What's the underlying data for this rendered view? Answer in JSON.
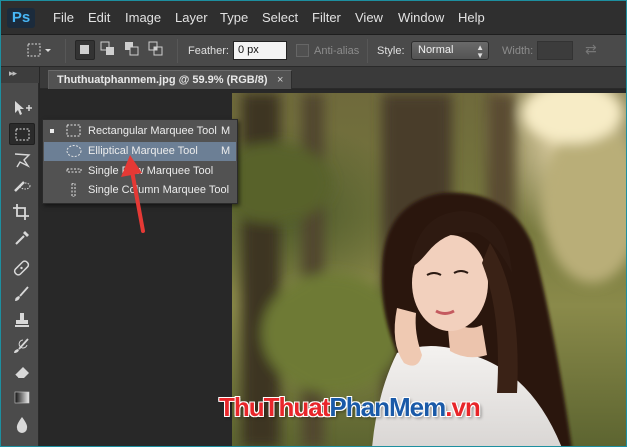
{
  "app": {
    "logo": "Ps",
    "accent_color": "#31a8ff"
  },
  "menu": [
    "File",
    "Edit",
    "Image",
    "Layer",
    "Type",
    "Select",
    "Filter",
    "View",
    "Window",
    "Help"
  ],
  "options_bar": {
    "feather_label": "Feather:",
    "feather_value": "0 px",
    "antialias_label": "Anti-alias",
    "style_label": "Style:",
    "style_value": "Normal",
    "width_label": "Width:"
  },
  "document_tab": {
    "title": "Thuthuatphanmem.jpg @ 59.9% (RGB/8)",
    "close": "×"
  },
  "tool_flyout": [
    {
      "label": "Rectangular Marquee Tool",
      "shortcut": "M",
      "selected": true,
      "icon": "rect-marquee-icon"
    },
    {
      "label": "Elliptical Marquee Tool",
      "shortcut": "M",
      "highlighted": true,
      "icon": "ellipse-marquee-icon"
    },
    {
      "label": "Single Row Marquee Tool",
      "shortcut": "",
      "icon": "single-row-icon"
    },
    {
      "label": "Single Column Marquee Tool",
      "shortcut": "",
      "icon": "single-column-icon"
    }
  ],
  "toolbox_tools": [
    "move-tool-icon",
    "rect-marquee-tool-icon",
    "lasso-tool-icon",
    "quick-selection-icon",
    "crop-tool-icon",
    "eyedropper-icon",
    "healing-brush-icon",
    "brush-tool-icon",
    "clone-stamp-icon",
    "history-brush-icon",
    "eraser-icon",
    "gradient-icon",
    "blur-tool-icon"
  ],
  "watermark": {
    "part1": "ThuThuat",
    "part2": "PhanMem",
    "part3": ".vn",
    "color_red": "#e8262a",
    "color_blue": "#1a5aa8"
  }
}
